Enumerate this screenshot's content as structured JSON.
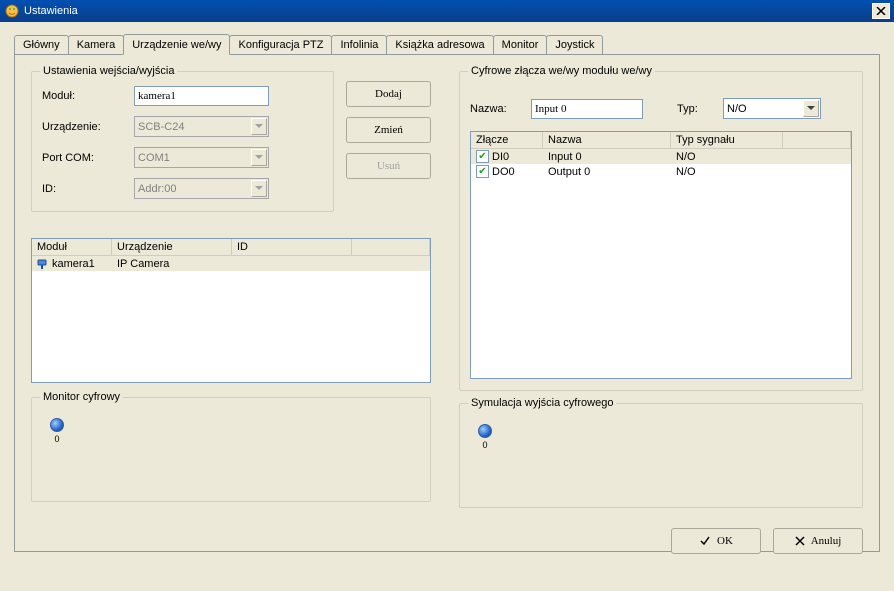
{
  "title": "Ustawienia",
  "tabs": [
    "Główny",
    "Kamera",
    "Urządzenie we/wy",
    "Konfiguracja PTZ",
    "Infolinia",
    "Książka adresowa",
    "Monitor",
    "Joystick"
  ],
  "active_tab": 2,
  "io_settings": {
    "legend": "Ustawienia wejścia/wyjścia",
    "module_label": "Moduł:",
    "module_value": "kamera1",
    "device_label": "Urządzenie:",
    "device_value": "SCB-C24",
    "port_label": "Port COM:",
    "port_value": "COM1",
    "id_label": "ID:",
    "id_value": "Addr:00"
  },
  "buttons": {
    "add": "Dodaj",
    "change": "Zmień",
    "delete": "Usuń"
  },
  "module_table": {
    "headers": [
      "Moduł",
      "Urządzenie",
      "ID"
    ],
    "rows": [
      {
        "module": "kamera1",
        "device": "IP Camera",
        "id": ""
      }
    ]
  },
  "digital_io": {
    "legend": "Cyfrowe złącza we/wy modułu we/wy",
    "name_label": "Nazwa:",
    "name_value": "Input 0",
    "type_label": "Typ:",
    "type_value": "N/O",
    "headers": [
      "Złącze",
      "Nazwa",
      "Typ sygnału"
    ],
    "rows": [
      {
        "checked": true,
        "conn": "DI0",
        "name": "Input 0",
        "sig": "N/O"
      },
      {
        "checked": true,
        "conn": "DO0",
        "name": "Output 0",
        "sig": "N/O"
      }
    ]
  },
  "monitor_group": {
    "legend": "Monitor cyfrowy",
    "value": "0"
  },
  "sim_group": {
    "legend": "Symulacja wyjścia cyfrowego",
    "value": "0"
  },
  "footer": {
    "ok": "OK",
    "cancel": "Anuluj"
  }
}
